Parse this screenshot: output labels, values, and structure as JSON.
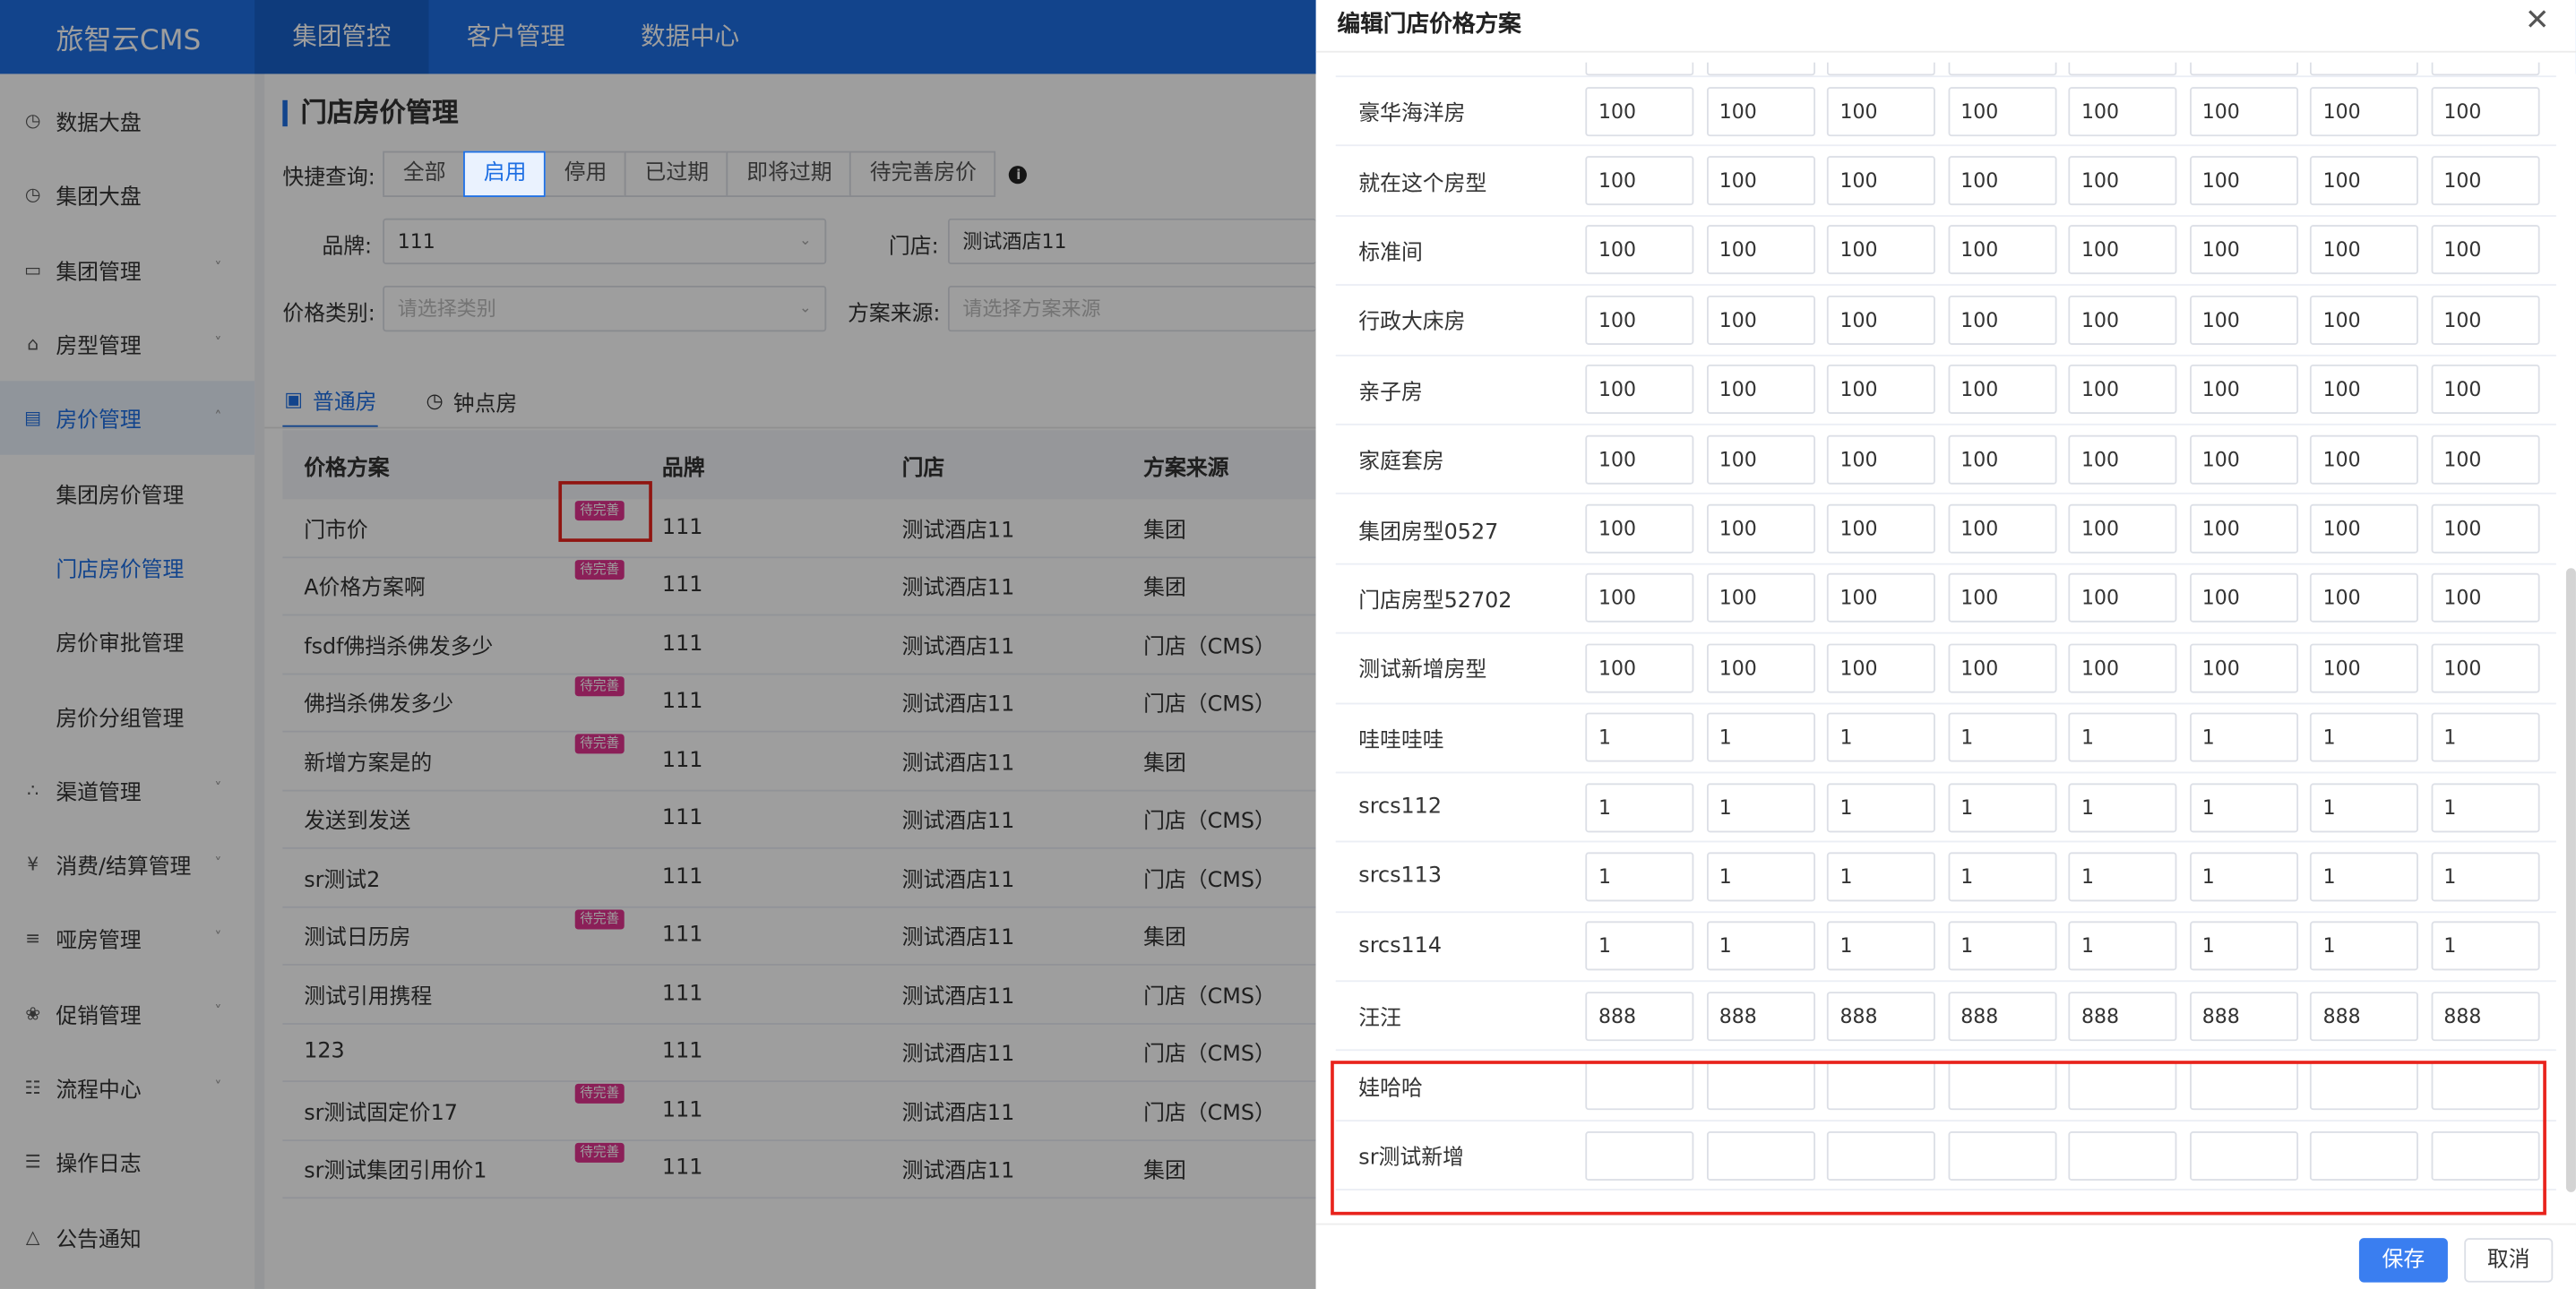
{
  "app": {
    "logo": "旅智云CMS"
  },
  "top_nav": [
    "集团管控",
    "客户管理",
    "数据中心"
  ],
  "sidebar": {
    "items": [
      {
        "label": "数据大盘",
        "icon": "clock-icon",
        "chevron": false
      },
      {
        "label": "集团大盘",
        "icon": "clock-icon",
        "chevron": false
      },
      {
        "label": "集团管理",
        "icon": "monitor-icon",
        "chevron": true
      },
      {
        "label": "房型管理",
        "icon": "home-icon",
        "chevron": true
      },
      {
        "label": "房价管理",
        "icon": "card-icon",
        "chevron": true,
        "open": true,
        "children": [
          "集团房价管理",
          "门店房价管理",
          "房价审批管理",
          "房价分组管理"
        ],
        "active_child": 1
      },
      {
        "label": "渠道管理",
        "icon": "network-icon",
        "chevron": true
      },
      {
        "label": "消费/结算管理",
        "icon": "yen-icon",
        "chevron": true
      },
      {
        "label": "哑房管理",
        "icon": "document-icon",
        "chevron": true
      },
      {
        "label": "促销管理",
        "icon": "gift-icon",
        "chevron": true
      },
      {
        "label": "流程中心",
        "icon": "clipboard-icon",
        "chevron": true
      },
      {
        "label": "操作日志",
        "icon": "file-icon",
        "chevron": false
      },
      {
        "label": "公告通知",
        "icon": "bell-icon",
        "chevron": false
      }
    ]
  },
  "main": {
    "title": "门店房价管理",
    "quick_label": "快捷查询:",
    "quick_buttons": [
      "全部",
      "启用",
      "停用",
      "已过期",
      "即将过期",
      "待完善房价"
    ],
    "quick_active": 1,
    "filters": {
      "brand_label": "品牌:",
      "brand_value": "111",
      "store_label": "门店:",
      "store_value": "测试酒店11",
      "price_type_label": "价格类别:",
      "price_type_placeholder": "请选择类别",
      "source_label": "方案来源:",
      "source_placeholder": "请选择方案来源"
    },
    "tabs": [
      "普通房",
      "钟点房"
    ],
    "table": {
      "headers": [
        "价格方案",
        "品牌",
        "门店",
        "方案来源"
      ],
      "badge_text": "待完善",
      "rows": [
        {
          "name": "门市价",
          "brand": "111",
          "store": "测试酒店11",
          "source": "集团",
          "badge": true
        },
        {
          "name": "A价格方案啊",
          "brand": "111",
          "store": "测试酒店11",
          "source": "集团",
          "badge": true
        },
        {
          "name": "fsdf佛挡杀佛发多少",
          "brand": "111",
          "store": "测试酒店11",
          "source": "门店（CMS）",
          "badge": false
        },
        {
          "name": "佛挡杀佛发多少",
          "brand": "111",
          "store": "测试酒店11",
          "source": "门店（CMS）",
          "badge": true
        },
        {
          "name": "新增方案是的",
          "brand": "111",
          "store": "测试酒店11",
          "source": "集团",
          "badge": true
        },
        {
          "name": "发送到发送",
          "brand": "111",
          "store": "测试酒店11",
          "source": "门店（CMS）",
          "badge": false
        },
        {
          "name": "sr测试2",
          "brand": "111",
          "store": "测试酒店11",
          "source": "门店（CMS）",
          "badge": false
        },
        {
          "name": "测试日历房",
          "brand": "111",
          "store": "测试酒店11",
          "source": "集团",
          "badge": true
        },
        {
          "name": "测试引用携程",
          "brand": "111",
          "store": "测试酒店11",
          "source": "门店（CMS）",
          "badge": false
        },
        {
          "name": "123",
          "brand": "111",
          "store": "测试酒店11",
          "source": "门店（CMS）",
          "badge": false
        },
        {
          "name": "sr测试固定价17",
          "brand": "111",
          "store": "测试酒店11",
          "source": "门店（CMS）",
          "badge": true
        },
        {
          "name": "sr测试集团引用价1",
          "brand": "111",
          "store": "测试酒店11",
          "source": "集团",
          "badge": true
        }
      ]
    }
  },
  "drawer": {
    "title": "编辑门店价格方案",
    "rows": [
      {
        "name": "",
        "values": [
          "",
          "",
          "",
          "",
          "",
          "",
          "",
          ""
        ]
      },
      {
        "name": "豪华海洋房",
        "values": [
          "100",
          "100",
          "100",
          "100",
          "100",
          "100",
          "100",
          "100"
        ]
      },
      {
        "name": "就在这个房型",
        "values": [
          "100",
          "100",
          "100",
          "100",
          "100",
          "100",
          "100",
          "100"
        ]
      },
      {
        "name": "标准间",
        "values": [
          "100",
          "100",
          "100",
          "100",
          "100",
          "100",
          "100",
          "100"
        ]
      },
      {
        "name": "行政大床房",
        "values": [
          "100",
          "100",
          "100",
          "100",
          "100",
          "100",
          "100",
          "100"
        ]
      },
      {
        "name": "亲子房",
        "values": [
          "100",
          "100",
          "100",
          "100",
          "100",
          "100",
          "100",
          "100"
        ]
      },
      {
        "name": "家庭套房",
        "values": [
          "100",
          "100",
          "100",
          "100",
          "100",
          "100",
          "100",
          "100"
        ]
      },
      {
        "name": "集团房型0527",
        "values": [
          "100",
          "100",
          "100",
          "100",
          "100",
          "100",
          "100",
          "100"
        ]
      },
      {
        "name": "门店房型52702",
        "values": [
          "100",
          "100",
          "100",
          "100",
          "100",
          "100",
          "100",
          "100"
        ]
      },
      {
        "name": "测试新增房型",
        "values": [
          "100",
          "100",
          "100",
          "100",
          "100",
          "100",
          "100",
          "100"
        ]
      },
      {
        "name": "哇哇哇哇",
        "values": [
          "1",
          "1",
          "1",
          "1",
          "1",
          "1",
          "1",
          "1"
        ]
      },
      {
        "name": "srcs112",
        "values": [
          "1",
          "1",
          "1",
          "1",
          "1",
          "1",
          "1",
          "1"
        ]
      },
      {
        "name": "srcs113",
        "values": [
          "1",
          "1",
          "1",
          "1",
          "1",
          "1",
          "1",
          "1"
        ]
      },
      {
        "name": "srcs114",
        "values": [
          "1",
          "1",
          "1",
          "1",
          "1",
          "1",
          "1",
          "1"
        ]
      },
      {
        "name": "汪汪",
        "values": [
          "888",
          "888",
          "888",
          "888",
          "888",
          "888",
          "888",
          "888"
        ]
      },
      {
        "name": "娃哈哈",
        "values": [
          "",
          "",
          "",
          "",
          "",
          "",
          "",
          ""
        ]
      },
      {
        "name": "sr测试新增",
        "values": [
          "",
          "",
          "",
          "",
          "",
          "",
          "",
          ""
        ]
      }
    ],
    "save_label": "保存",
    "cancel_label": "取消"
  },
  "colors": {
    "primary": "#1e6fe3",
    "badge": "#e0328e",
    "highlight": "#e8231c"
  }
}
